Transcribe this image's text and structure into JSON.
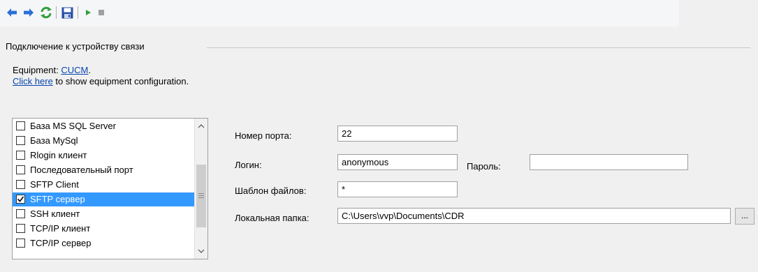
{
  "toolbar": {
    "buttons": [
      {
        "icon": "arrow-left-icon",
        "color": "#2b6fd6"
      },
      {
        "icon": "arrow-right-icon",
        "color": "#2b6fd6"
      },
      {
        "icon": "refresh-icon",
        "color": "#2e9e3a"
      },
      {
        "icon": "save-icon",
        "color": "#2a4fa8"
      },
      {
        "icon": "play-icon",
        "color": "#2e9e3a"
      },
      {
        "icon": "stop-icon",
        "color": "#a0a0a0"
      }
    ]
  },
  "group": {
    "title": "Подключение к устройству связи"
  },
  "equipment": {
    "prefix": "Equipment: ",
    "link": "CUCM",
    "suffix": ".",
    "config_link": "Click here",
    "config_text": " to show equipment configuration."
  },
  "connection_list": {
    "items": [
      {
        "label": "База MS SQL Server",
        "checked": false,
        "selected": false
      },
      {
        "label": "База MySql",
        "checked": false,
        "selected": false
      },
      {
        "label": "Rlogin клиент",
        "checked": false,
        "selected": false
      },
      {
        "label": "Последовательный порт",
        "checked": false,
        "selected": false
      },
      {
        "label": "SFTP Client",
        "checked": false,
        "selected": false
      },
      {
        "label": "SFTP сервер",
        "checked": true,
        "selected": true
      },
      {
        "label": "SSH клиент",
        "checked": false,
        "selected": false
      },
      {
        "label": "TCP/IP клиент",
        "checked": false,
        "selected": false
      },
      {
        "label": "TCP/IP сервер",
        "checked": false,
        "selected": false
      }
    ]
  },
  "form": {
    "port_label": "Номер порта:",
    "port_value": "22",
    "login_label": "Логин:",
    "login_value": "anonymous",
    "password_label": "Пароль:",
    "password_value": "",
    "template_label": "Шаблон файлов:",
    "template_value": "*",
    "folder_label": "Локальная папка:",
    "folder_value": "C:\\Users\\vvp\\Documents\\CDR",
    "browse_label": "..."
  },
  "colors": {
    "selection": "#3399ff",
    "link": "#0645ad"
  }
}
